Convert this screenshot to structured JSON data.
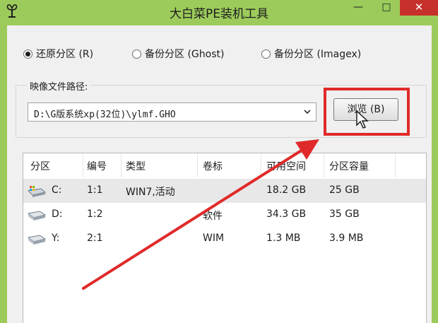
{
  "window": {
    "title": "大白菜PE装机工具",
    "minimize_glyph": "—",
    "maximize_glyph": "□",
    "close_glyph": "✕"
  },
  "mode": {
    "options": [
      {
        "label": "还原分区 (R)",
        "checked": true
      },
      {
        "label": "备份分区 (Ghost)",
        "checked": false
      },
      {
        "label": "备份分区 (Imagex)",
        "checked": false
      }
    ]
  },
  "image_path": {
    "label": "映像文件路径:",
    "value": "D:\\G版系统xp(32位)\\ylmf.GHO",
    "browse_label": "浏览 (B)"
  },
  "partitions": {
    "columns": [
      "分区",
      "编号",
      "类型",
      "卷标",
      "可用空间",
      "分区容量"
    ],
    "rows": [
      {
        "drive": "C:",
        "number": "1:1",
        "type": "WIN7,活动",
        "label": "",
        "free": "18.2 GB",
        "size": "25 GB",
        "icon": "windows-drive-icon",
        "selected": true
      },
      {
        "drive": "D:",
        "number": "1:2",
        "type": "",
        "label": "软件",
        "free": "34.3 GB",
        "size": "35 GB",
        "icon": "hard-drive-icon",
        "selected": false
      },
      {
        "drive": "Y:",
        "number": "2:1",
        "type": "",
        "label": "WIM",
        "free": "1.3 MB",
        "size": "3.9 MB",
        "icon": "hard-drive-icon",
        "selected": false
      }
    ]
  },
  "colors": {
    "title_bar": "#9ccb5b",
    "close_button": "#c7312b",
    "highlight": "#e02a2a",
    "selected_row": "#e8e8e8"
  },
  "icons": [
    "app-icon",
    "dropdown-arrow-icon",
    "mouse-cursor-icon",
    "windows-drive-icon",
    "hard-drive-icon",
    "annotation-arrow"
  ]
}
